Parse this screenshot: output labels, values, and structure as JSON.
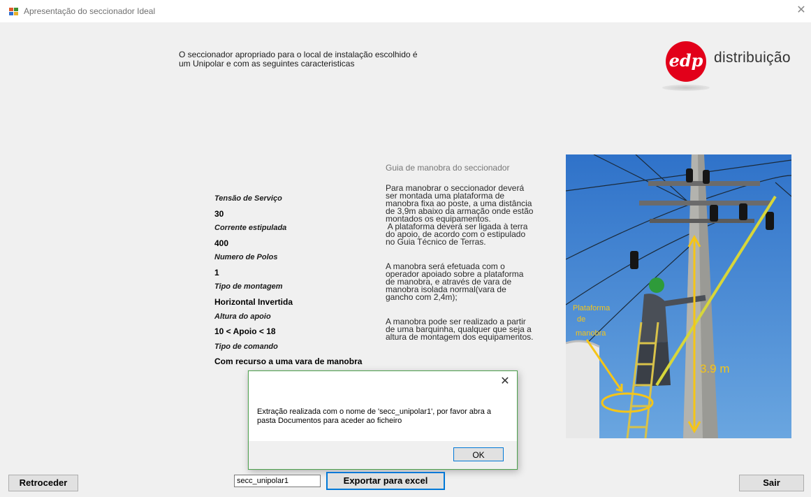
{
  "window": {
    "title": "Apresentação do seccionador Ideal",
    "close_glyph": "✕"
  },
  "intro": {
    "line1": "O seccionador apropriado para o local de instalação escolhido é",
    "line2": "um Unipolar e com as seguintes caracteristicas"
  },
  "logo": {
    "mark": "edp",
    "text": "distribuição",
    "brand_color": "#e2001a"
  },
  "specs": [
    {
      "label": "Tensão de Serviço",
      "value": "30"
    },
    {
      "label": "Corrente estipulada",
      "value": "400"
    },
    {
      "label": "Numero de Polos",
      "value": "1"
    },
    {
      "label": "Tipo de montagem",
      "value": "Horizontal Invertida"
    },
    {
      "label": "Altura do apoio",
      "value": "10 < Apoio < 18"
    },
    {
      "label": "Tipo de comando",
      "value": "Com recurso a uma vara de manobra"
    }
  ],
  "guide": {
    "title": "Guia de manobra do seccionador",
    "p1": [
      "Para manobrar o seccionador deverá",
      "ser montada uma plataforma de",
      "manobra fixa ao poste, a uma distância",
      "de 3,9m abaixo da armação onde estão",
      "montados os equipamentos.",
      " A plataforma deverá ser ligada à terra",
      "do apoio, de acordo com o estipulado",
      "no Guia Técnico de Terras."
    ],
    "p2": [
      "A manobra será efetuada com o",
      "operador apoiado sobre a plataforma",
      "de manobra, e através de vara de",
      "manobra isolada normal(vara de",
      "gancho com 2,4m);"
    ],
    "p3": [
      "A manobra pode ser realizado a partir",
      "de uma barquinha, qualquer que seja a",
      "altura de montagem dos equipamentos."
    ]
  },
  "photo": {
    "label_platform": [
      "Plataforma",
      "de",
      "manobra"
    ],
    "label_height": "3.9 m",
    "annotation_color": "#f5c518"
  },
  "dialog": {
    "message_line1": "Extração realizada com o nome de 'secc_unipolar1', por favor abra a",
    "message_line2": "pasta Documentos para aceder ao ficheiro",
    "ok_label": "OK",
    "close_glyph": "✕"
  },
  "bottom": {
    "back_label": "Retroceder",
    "filename_value": "secc_unipolar1",
    "export_label": "Exportar para excel",
    "exit_label": "Sair"
  }
}
